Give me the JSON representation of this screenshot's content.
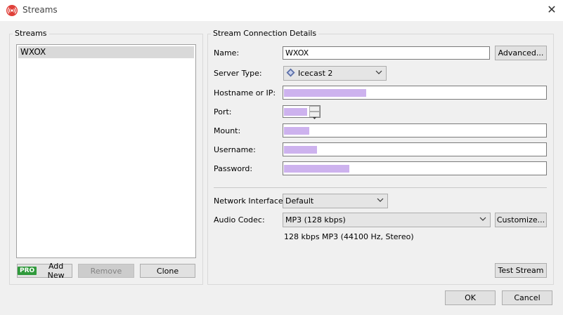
{
  "window": {
    "title": "Streams",
    "close_glyph": "✕"
  },
  "streams": {
    "group_label": "Streams",
    "items": [
      "WXOX"
    ],
    "buttons": {
      "pro_badge": "PRO",
      "add_new": "Add New",
      "remove": "Remove",
      "clone": "Clone"
    }
  },
  "details": {
    "group_label": "Stream Connection Details",
    "name_label": "Name:",
    "name_value": "WXOX",
    "advanced_button": "Advanced...",
    "server_type_label": "Server Type:",
    "server_type_value": "Icecast 2",
    "hostname_label": "Hostname or IP:",
    "port_label": "Port:",
    "mount_label": "Mount:",
    "username_label": "Username:",
    "password_label": "Password:",
    "network_interface_label": "Network Interface:",
    "network_interface_value": "Default",
    "audio_codec_label": "Audio Codec:",
    "audio_codec_value": "MP3 (128 kbps)",
    "customize_button": "Customize...",
    "codec_info": "128 kbps MP3 (44100 Hz, Stereo)",
    "test_stream_button": "Test Stream"
  },
  "dialog_buttons": {
    "ok": "OK",
    "cancel": "Cancel"
  },
  "colors": {
    "redaction": "#cdb2ee",
    "pro_badge": "#2f9a3b",
    "app_icon": "#e0403a"
  },
  "icons": {
    "app": "broadcast-icon",
    "server": "icecast-icon",
    "dropdown": "chevron-down-icon",
    "spin_up": "spin-up-icon",
    "spin_down": "spin-down-icon"
  }
}
